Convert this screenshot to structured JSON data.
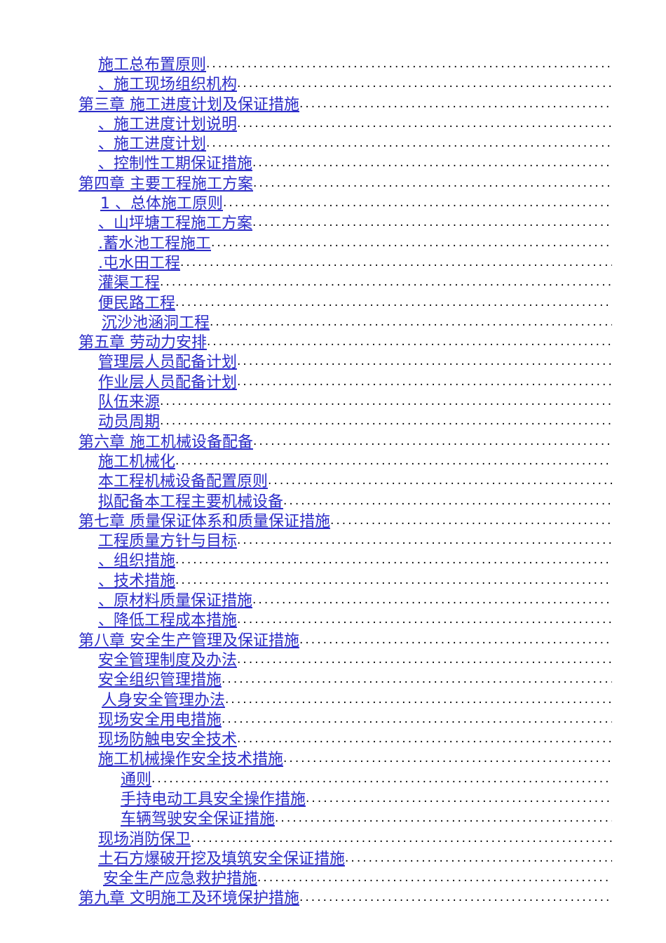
{
  "document": {
    "type": "table-of-contents",
    "language": "zh-CN",
    "text_color": "#2B2BC8",
    "leader_color": "#000000",
    "background": "#ffffff"
  },
  "toc": {
    "entries": [
      {
        "label": "施工总布置原则",
        "level": 1
      },
      {
        "label": "、施工现场组织机构",
        "level": 1
      },
      {
        "label": "第三章  施工进度计划及保证措施",
        "level": 0
      },
      {
        "label": "、施工进度计划说明",
        "level": 1
      },
      {
        "label": "、施工进度计划",
        "level": 1
      },
      {
        "label": "、控制性工期保证措施",
        "level": 1
      },
      {
        "label": "第四章  主要工程施工方案",
        "level": 0
      },
      {
        "label": "1 、总体施工原则",
        "level": 1
      },
      {
        "label": "、山坪塘工程施工方案",
        "level": 1
      },
      {
        "label": ".蓄水池工程施工",
        "level": 1
      },
      {
        "label": ".屯水田工程",
        "level": 1
      },
      {
        "label": "灌渠工程",
        "level": 1
      },
      {
        "label": "便民路工程",
        "level": 1
      },
      {
        "label": "沉沙池涵洞工程",
        "level": 1
      },
      {
        "label": "第五章  劳动力安排",
        "level": 0
      },
      {
        "label": "管理层人员配备计划",
        "level": 1
      },
      {
        "label": "作业层人员配备计划",
        "level": 1
      },
      {
        "label": "队伍来源",
        "level": 1
      },
      {
        "label": "动员周期",
        "level": 1
      },
      {
        "label": "第六章  施工机械设备配备",
        "level": 0
      },
      {
        "label": "施工机械化",
        "level": 1
      },
      {
        "label": "本工程机械设备配置原则",
        "level": 1
      },
      {
        "label": "拟配备本工程主要机械设备",
        "level": 1
      },
      {
        "label": "第七章  质量保证体系和质量保证措施",
        "level": 0
      },
      {
        "label": "工程质量方针与目标",
        "level": 1
      },
      {
        "label": "、组织措施",
        "level": 1
      },
      {
        "label": "、技术措施",
        "level": 1
      },
      {
        "label": "、原材料质量保证措施",
        "level": 1
      },
      {
        "label": "、降低工程成本措施",
        "level": 1
      },
      {
        "label": "第八章  安全生产管理及保证措施",
        "level": 0
      },
      {
        "label": "安全管理制度及办法",
        "level": 1
      },
      {
        "label": "安全组织管理措施",
        "level": 1
      },
      {
        "label": "人身安全管理办法",
        "level": 1
      },
      {
        "label": "现场安全用电措施",
        "level": 1
      },
      {
        "label": "现场防触电安全技术",
        "level": 1
      },
      {
        "label": "施工机械操作安全技术措施",
        "level": 1
      },
      {
        "label": "通则",
        "level": 2
      },
      {
        "label": "手持电动工具安全操作措施",
        "level": 2
      },
      {
        "label": "车辆驾驶安全保证措施",
        "level": 2
      },
      {
        "label": "现场消防保卫",
        "level": 1
      },
      {
        "label": "土石方爆破开挖及填筑安全保证措施",
        "level": 1
      },
      {
        "label": "安全生产应急救护措施",
        "level": 1
      },
      {
        "label": "第九章  文明施工及环境保护措施",
        "level": 0
      }
    ]
  }
}
